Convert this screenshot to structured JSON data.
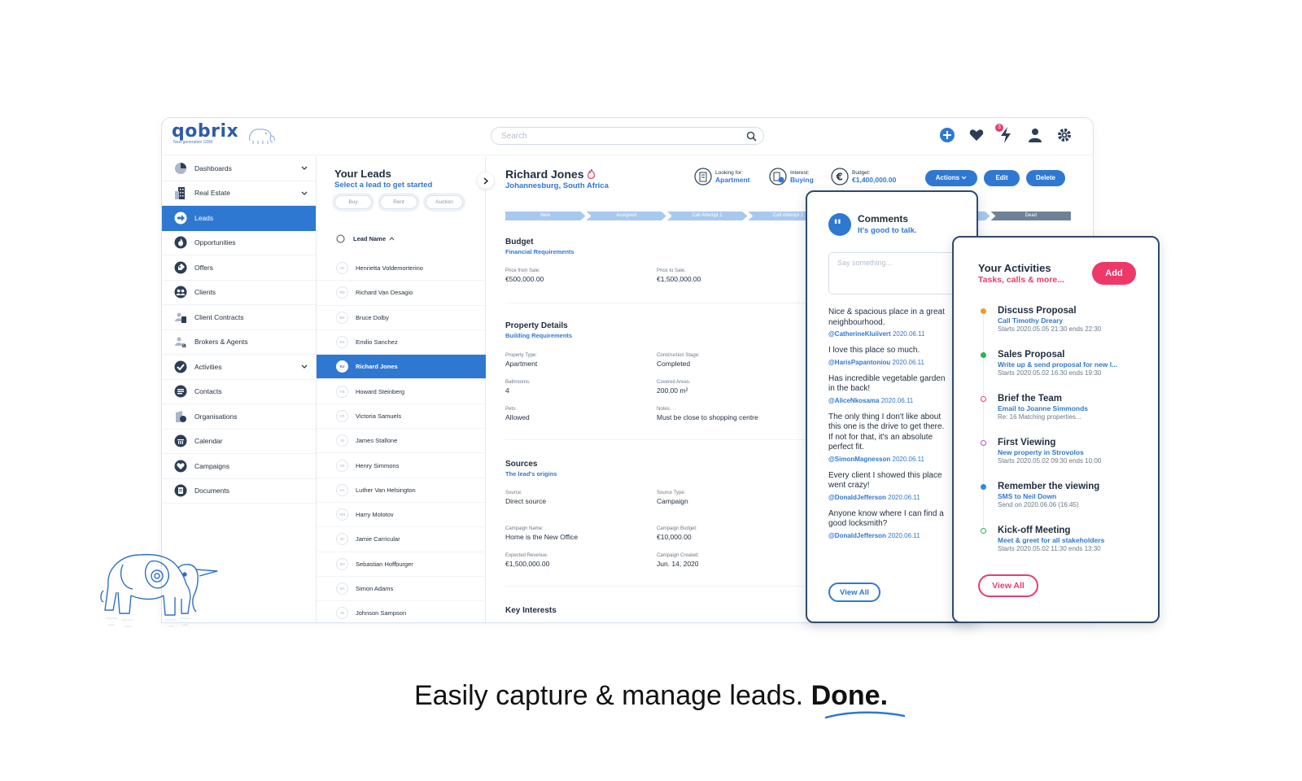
{
  "app": {
    "logo": "qobrix",
    "logo_sub": "Next generation CRM"
  },
  "search": {
    "placeholder": "Search"
  },
  "topbar": {
    "notification_count": "3"
  },
  "sidebar": {
    "items": [
      {
        "label": "Dashboards",
        "icon": "pie-chart-icon",
        "expandable": true
      },
      {
        "label": "Real Estate",
        "icon": "building-icon",
        "expandable": true
      },
      {
        "label": "Leads",
        "icon": "lead-arrow-icon",
        "expandable": false,
        "active": true
      },
      {
        "label": "Opportunities",
        "icon": "flame-icon",
        "expandable": false
      },
      {
        "label": "Offers",
        "icon": "tag-icon",
        "expandable": false
      },
      {
        "label": "Clients",
        "icon": "clients-icon",
        "expandable": false
      },
      {
        "label": "Client Contracts",
        "icon": "contract-icon",
        "expandable": false
      },
      {
        "label": "Brokers & Agents",
        "icon": "agent-icon",
        "expandable": false
      },
      {
        "label": "Activities",
        "icon": "check-icon",
        "expandable": true
      },
      {
        "label": "Contacts",
        "icon": "contacts-icon",
        "expandable": false
      },
      {
        "label": "Organisations",
        "icon": "organisation-icon",
        "expandable": false
      },
      {
        "label": "Calendar",
        "icon": "calendar-icon",
        "expandable": false
      },
      {
        "label": "Campaigns",
        "icon": "heart-icon",
        "expandable": false
      },
      {
        "label": "Documents",
        "icon": "document-icon",
        "expandable": false
      }
    ]
  },
  "leads": {
    "title": "Your Leads",
    "subtitle": "Select a lead to get started",
    "filters": [
      "Buy",
      "Rent",
      "Auction"
    ],
    "column_header": "Lead Name",
    "rows": [
      {
        "initials": "HV",
        "name": "Henrietta Voldemorterino"
      },
      {
        "initials": "RD",
        "name": "Richard Van Desagio"
      },
      {
        "initials": "BD",
        "name": "Bruce Dolby"
      },
      {
        "initials": "ES",
        "name": "Emilio Sanchez"
      },
      {
        "initials": "RJ",
        "name": "Richard Jones",
        "active": true
      },
      {
        "initials": "HS",
        "name": "Howard Steinberg"
      },
      {
        "initials": "VS",
        "name": "Victoria Samuels"
      },
      {
        "initials": "JS",
        "name": "James Stallone"
      },
      {
        "initials": "HS",
        "name": "Henry Simmons"
      },
      {
        "initials": "LH",
        "name": "Luther Van Helsington"
      },
      {
        "initials": "HM",
        "name": "Harry Molotov"
      },
      {
        "initials": "JC",
        "name": "Jamie Carricular"
      },
      {
        "initials": "SH",
        "name": "Sebastian Hoffburger"
      },
      {
        "initials": "SA",
        "name": "Simon Adams"
      },
      {
        "initials": "JS",
        "name": "Johnson Sampson"
      }
    ]
  },
  "detail": {
    "name": "Richard Jones",
    "location": "Johannesburg, South Africa",
    "looking_for_label": "Looking for:",
    "looking_for": "Apartment",
    "interest_label": "Interest:",
    "interest": "Buying",
    "budget_label": "Budget:",
    "budget": "€1,400,000.00",
    "actions_label": "Actions",
    "edit_label": "Edit",
    "delete_label": "Delete",
    "pipeline": [
      "New",
      "Assigned",
      "Call Attempt 1",
      "Call Attempt 2",
      "",
      "",
      "Dead"
    ],
    "budget_section": {
      "title": "Budget",
      "subtitle": "Financial Requirements",
      "price_from_label": "Price from Sale:",
      "price_from": "€500,000.00",
      "price_to_label": "Price to Sale:",
      "price_to": "€1,500,000.00"
    },
    "property_section": {
      "title": "Property Details",
      "subtitle": "Building Requirements",
      "type_label": "Property Type:",
      "type": "Apartment",
      "stage_label": "Construction Stage:",
      "stage": "Completed",
      "bathrooms_label": "Bathrooms:",
      "bathrooms": "4",
      "covered_label": "Covered Areas:",
      "covered": "200.00 m²",
      "pets_label": "Pets:",
      "pets": "Allowed",
      "notes_label": "Notes:",
      "notes": "Must be close to shopping centre"
    },
    "sources_section": {
      "title": "Sources",
      "subtitle": "The lead's origins",
      "source_label": "Source:",
      "source": "Direct source",
      "source_type_label": "Source Type:",
      "source_type": "Campaign",
      "campaign_name_label": "Campaign Name:",
      "campaign_name": "Home is the New Office",
      "campaign_budget_label": "Campaign Budget:",
      "campaign_budget": "€10,000.00",
      "expected_revenue_label": "Expected Revenue:",
      "expected_revenue": "€1,500,000.00",
      "campaign_created_label": "Campaign Created:",
      "campaign_created": "Jun. 14, 2020"
    },
    "key_interests_title": "Key Interests"
  },
  "comments": {
    "title": "Comments",
    "subtitle": "It's good to talk.",
    "placeholder": "Say something...",
    "items": [
      {
        "text": "Nice & spacious place in a great\nneighbourhood.",
        "user": "@CatherineKluiivert",
        "date": "2020.06.11"
      },
      {
        "text": "I love this place so much.",
        "user": "@HarisPapantoniou",
        "date": "2020.06.11"
      },
      {
        "text": "Has incredible vegetable garden\nin the back!",
        "user": "@AliceNkosama",
        "date": "2020.06.11"
      },
      {
        "text": "The only thing I don't like about\nthis one is the drive to get there.\nIf not for that, it's an absolute\nperfect fit.",
        "user": "@SimonMagnesson",
        "date": "2020.06.11"
      },
      {
        "text": "Every client I showed this place\nwent crazy!",
        "user": "@DonaldJefferson",
        "date": "2020.06.11"
      },
      {
        "text": "Anyone know where I can find a\ngood locksmith?",
        "user": "@DonaldJefferson",
        "date": "2020.06.11"
      }
    ],
    "view_all": "View All"
  },
  "activities": {
    "title": "Your Activities",
    "subtitle": "Tasks, calls & more...",
    "add_label": "Add",
    "items": [
      {
        "name": "Discuss Proposal",
        "desc": "Call Timothy Dreary",
        "time": "Starts 2020.05.05 21:30 ends 22:30",
        "color": "#f29a2e",
        "hollow": false
      },
      {
        "name": "Sales Proposal",
        "desc": "Write up & send proposal for new l...",
        "time": "Starts 2020.05.02 16:30 ends 19:30",
        "color": "#27b35a",
        "hollow": false
      },
      {
        "name": "Brief the Team",
        "desc": "Email to Joanne Simmonds",
        "time": "Re: 16 Matching properties...",
        "color": "#e63d6d",
        "hollow": true
      },
      {
        "name": "First Viewing",
        "desc": "New property in Strovolos",
        "time": "Starts 2020.05.02 09:30 ends 10:00",
        "color": "#b94fc8",
        "hollow": true
      },
      {
        "name": "Remember the viewing",
        "desc": "SMS to Neil Down",
        "time": "Send on 2020.06.06 (16:45)",
        "color": "#2f8be0",
        "hollow": false
      },
      {
        "name": "Kick-off Meeting",
        "desc": "Meet & greet for all stakeholders",
        "time": "Starts 2020.05.02 11:30 ends 13:30",
        "color": "#27b35a",
        "hollow": true
      }
    ],
    "view_all": "View All"
  },
  "tagline": {
    "text": "Easily capture & manage leads.",
    "emphasis": "Done."
  },
  "colors": {
    "primary": "#2f78d2",
    "accent": "#ee3868",
    "dark": "#2f4a6d"
  }
}
